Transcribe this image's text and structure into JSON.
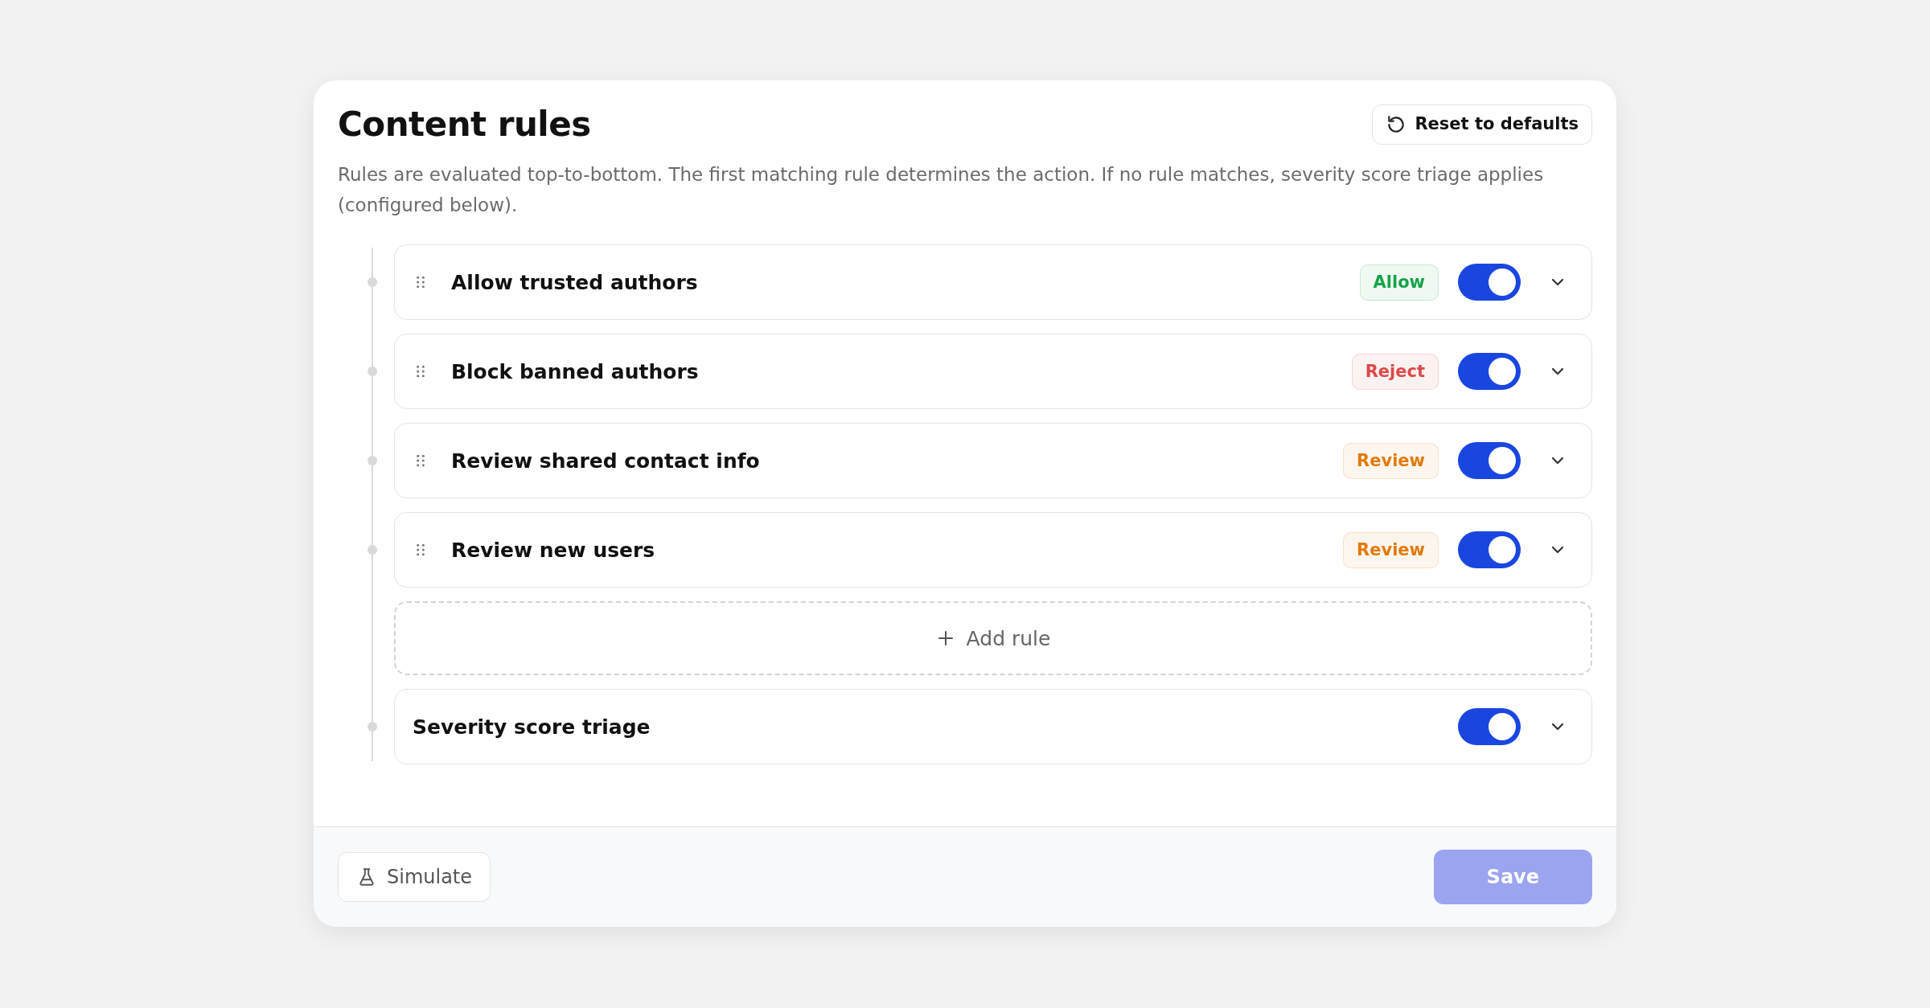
{
  "title": "Content rules",
  "reset_button": "Reset to defaults",
  "description": "Rules are evaluated top-to-bottom. The first matching rule determines the action. If no rule matches, severity score triage applies (configured below).",
  "rules": [
    {
      "kind": "rule",
      "name": "Allow trusted authors",
      "action": {
        "label": "Allow",
        "color": "#16a34a"
      },
      "on": true,
      "expanded": false
    },
    {
      "kind": "rule",
      "name": "Block banned authors",
      "action": {
        "label": "Reject",
        "color": "#dc4a4a"
      },
      "on": true,
      "expanded": false
    },
    {
      "kind": "rule",
      "name": "Review shared contact info",
      "action": {
        "label": "Review",
        "color": "#e27a0c"
      },
      "on": true,
      "expanded": false
    },
    {
      "kind": "rule",
      "name": "Review new users",
      "action": {
        "label": "Review",
        "color": "#e27a0c"
      },
      "on": true,
      "expanded": false
    },
    {
      "kind": "add",
      "label": "Add rule"
    },
    {
      "kind": "fallback",
      "name": "Severity score triage",
      "on": true,
      "expanded": false
    }
  ],
  "footer": {
    "simulate_button": "Simulate",
    "save_button": {
      "label": "Save",
      "disabled": true
    }
  }
}
